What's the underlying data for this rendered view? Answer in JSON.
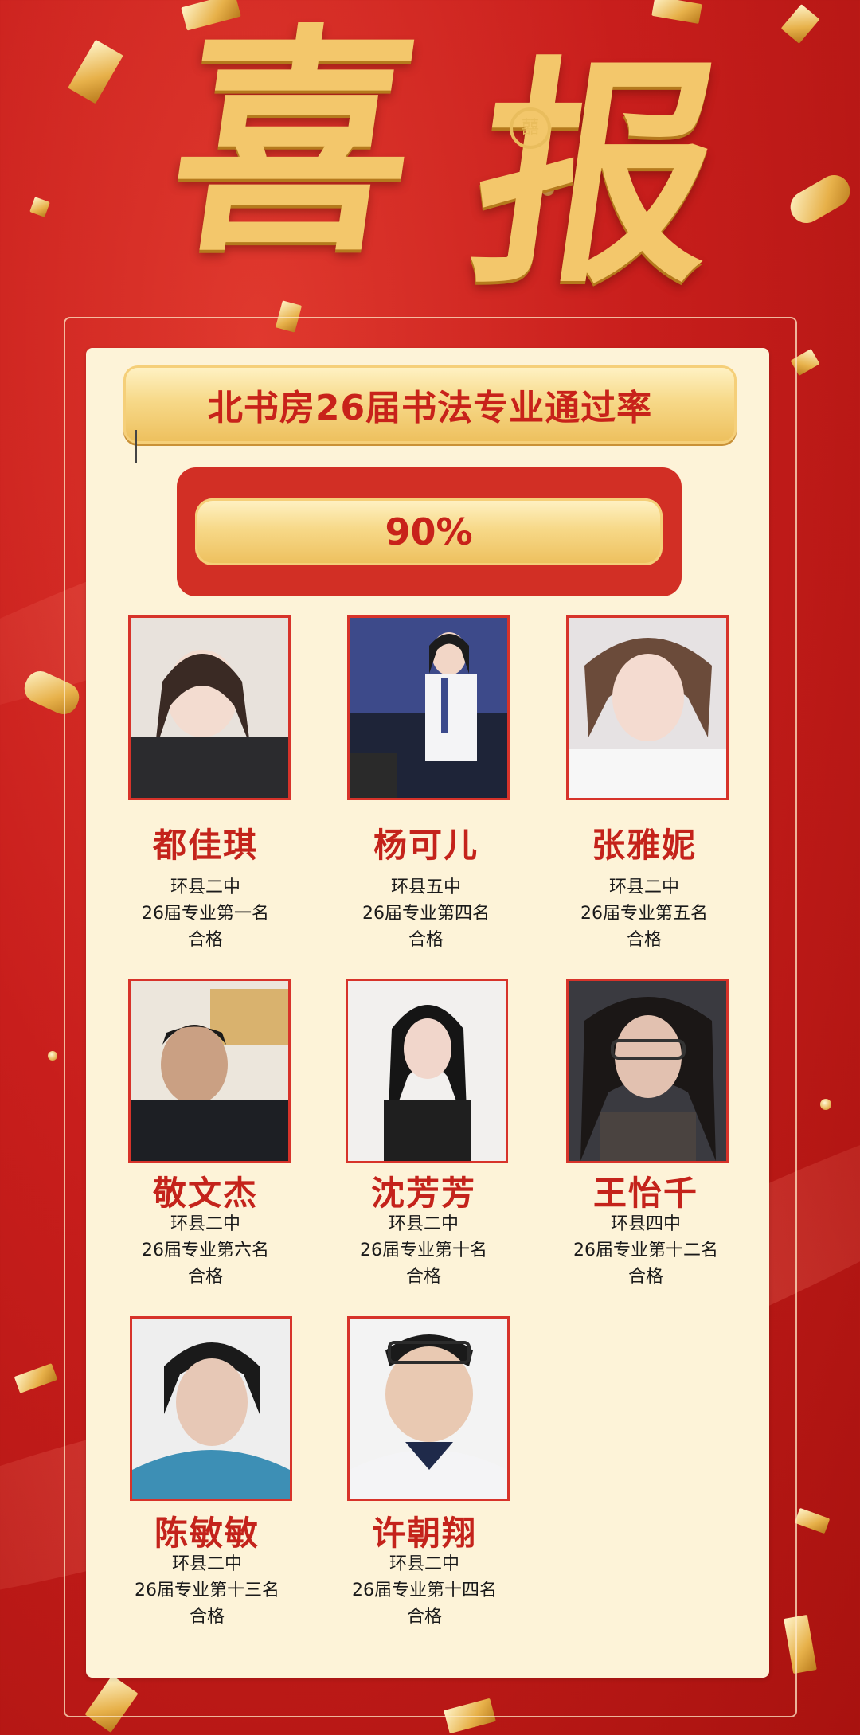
{
  "poster": {
    "title_char_1": "喜",
    "title_char_2": "报",
    "banner": "北书房26届书法专业通过率",
    "pass_rate": "90%"
  },
  "students": [
    {
      "name": "都佳琪",
      "school": "环县二中",
      "rank": "26届专业第一名",
      "result": "合格"
    },
    {
      "name": "杨可儿",
      "school": "环县五中",
      "rank": "26届专业第四名",
      "result": "合格"
    },
    {
      "name": "张雅妮",
      "school": "环县二中",
      "rank": "26届专业第五名",
      "result": "合格"
    },
    {
      "name": "敬文杰",
      "school": "环县二中",
      "rank": "26届专业第六名",
      "result": "合格"
    },
    {
      "name": "沈芳芳",
      "school": "环县二中",
      "rank": "26届专业第十名",
      "result": "合格"
    },
    {
      "name": "王怡千",
      "school": "环县四中",
      "rank": "26届专业第十二名",
      "result": "合格"
    },
    {
      "name": "陈敏敏",
      "school": "环县二中",
      "rank": "26届专业第十三名",
      "result": "合格"
    },
    {
      "name": "许朝翔",
      "school": "环县二中",
      "rank": "26届专业第十四名",
      "result": "合格"
    }
  ],
  "colors": {
    "red": "#c8221a",
    "gold": "#f3c76b",
    "cream": "#fdf3d8"
  }
}
